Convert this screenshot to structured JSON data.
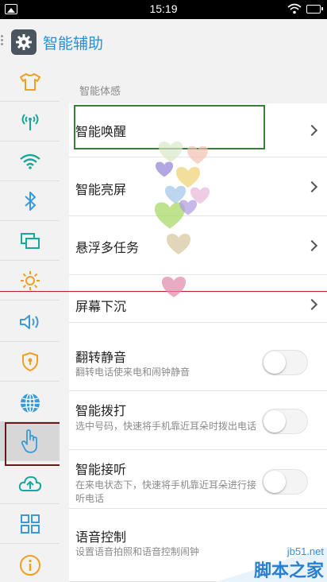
{
  "status_bar": {
    "time": "15:19"
  },
  "header": {
    "title": "智能辅助"
  },
  "sidebar": {
    "items": [
      {
        "icon": "tshirt-icon",
        "color": "#f0a020"
      },
      {
        "icon": "signal-tower-icon",
        "color": "#18a89a"
      },
      {
        "icon": "wifi-icon",
        "color": "#18a89a"
      },
      {
        "icon": "bluetooth-icon",
        "color": "#3a9ad8"
      },
      {
        "icon": "screens-icon",
        "color": "#18a89a"
      },
      {
        "icon": "brightness-icon",
        "color": "#f0a020"
      },
      {
        "icon": "volume-icon",
        "color": "#3a9ad8"
      },
      {
        "icon": "security-shield-icon",
        "color": "#f0a020"
      },
      {
        "icon": "globe-icon",
        "color": "#3a9ad8"
      },
      {
        "icon": "hand-gesture-icon",
        "color": "#3a9ad8",
        "active": true
      },
      {
        "icon": "cloud-upload-icon",
        "color": "#18a89a"
      },
      {
        "icon": "apps-grid-icon",
        "color": "#3a9ad8"
      },
      {
        "icon": "info-icon",
        "color": "#f0a020"
      }
    ]
  },
  "content": {
    "section_label": "智能体感",
    "rows": [
      {
        "label": "智能唤醒",
        "type": "nav"
      },
      {
        "label": "智能亮屏",
        "type": "nav"
      },
      {
        "label": "悬浮多任务",
        "type": "nav"
      },
      {
        "label": "屏幕下沉",
        "type": "nav"
      },
      {
        "label": "翻转静音",
        "sub": "翻转电话使来电和闹钟静音",
        "type": "toggle",
        "on": false
      },
      {
        "label": "智能拨打",
        "sub": "选中号码，快速将手机靠近耳朵时拨出电话",
        "type": "toggle",
        "on": false
      },
      {
        "label": "智能接听",
        "sub": "在来电状态下，快速将手机靠近耳朵进行接听电话",
        "type": "toggle",
        "on": false
      },
      {
        "label": "语音控制",
        "sub": "设置语音拍照和语音控制闹钟",
        "type": "nav"
      }
    ]
  },
  "watermark": {
    "small": "jb51.net",
    "big": "脚本之家"
  },
  "colors": {
    "accent": "#2b8fd6",
    "highlight": "#3a7d3a",
    "marker": "#c8182c",
    "active_frame": "#6b1a1a"
  }
}
